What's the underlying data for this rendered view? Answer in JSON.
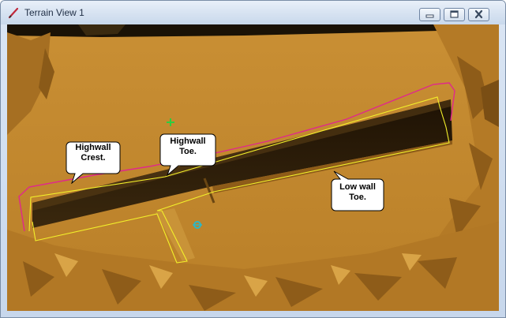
{
  "window": {
    "title": "Terrain View 1",
    "icons": {
      "app": "pencil-icon",
      "minimize": "minimize-icon",
      "maximize": "maximize-icon",
      "close": "close-icon"
    }
  },
  "labels": {
    "highwall_crest": {
      "line1": "Highwall",
      "line2": "Crest."
    },
    "highwall_toe": {
      "line1": "Highwall",
      "line2": "Toe."
    },
    "lowwall_toe": {
      "line1": "Low wall",
      "line2": "Toe."
    }
  },
  "colors": {
    "terrain": "#c68a2c",
    "pit_floor": "#2b1c08",
    "crest_line": "#e0288c",
    "toe_line": "#f3f02a",
    "cursor_marker": "#2ecc40",
    "survey_marker": "#2ab8c8"
  }
}
